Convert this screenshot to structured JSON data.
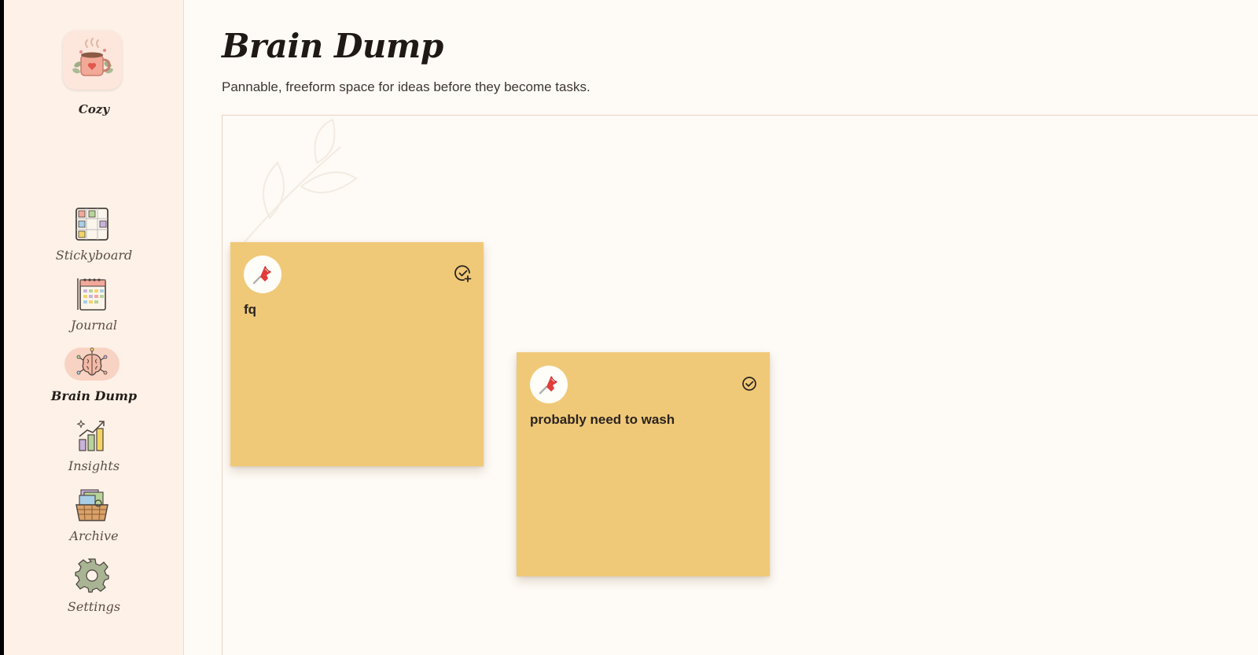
{
  "brand": {
    "name": "Cozy",
    "logo_icon": "coffee-mug-icon"
  },
  "sidebar": {
    "items": [
      {
        "label": "Stickyboard",
        "icon": "stickyboard-icon",
        "active": false
      },
      {
        "label": "Journal",
        "icon": "calendar-journal-icon",
        "active": false
      },
      {
        "label": "Brain Dump",
        "icon": "brain-icon",
        "active": true
      },
      {
        "label": "Insights",
        "icon": "bar-chart-icon",
        "active": false
      },
      {
        "label": "Archive",
        "icon": "basket-icon",
        "active": false
      },
      {
        "label": "Settings",
        "icon": "gear-icon",
        "active": false
      }
    ]
  },
  "header": {
    "title": "Brain Dump",
    "subtitle": "Pannable, freeform space for ideas before they become tasks."
  },
  "notes": [
    {
      "text": "fq",
      "color": "#f0c978",
      "pin_icon": "pushpin-icon",
      "action_icon": "check-add-icon"
    },
    {
      "text": "probably need to wash",
      "color": "#f0c978",
      "pin_icon": "pushpin-icon",
      "action_icon": "check-circle-icon"
    }
  ],
  "colors": {
    "sidebar_bg": "#fdf1e8",
    "canvas_bg": "#fefaf5",
    "note_yellow": "#f0c978",
    "active_pill": "#f8d3c3"
  }
}
